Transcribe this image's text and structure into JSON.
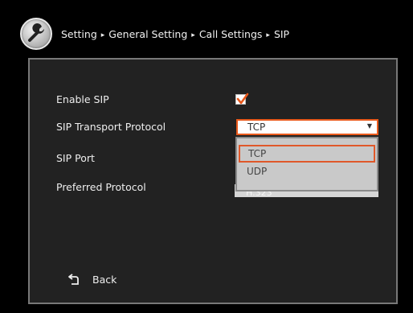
{
  "breadcrumb": {
    "items": [
      "Setting",
      "General Setting",
      "Call Settings",
      "SIP"
    ],
    "separator": "▸"
  },
  "form": {
    "enable_sip_label": "Enable SIP",
    "enable_sip_checked": true,
    "transport_label": "SIP Transport Protocol",
    "transport_value": "TCP",
    "sip_port_label": "SIP Port",
    "preferred_label": "Preferred Protocol",
    "preferred_value_partial": "H.323"
  },
  "dropdown": {
    "options": [
      "TCP",
      "UDP"
    ],
    "selected": "TCP"
  },
  "back_label": "Back",
  "colors": {
    "accent": "#e8571a",
    "panel_bg": "#222222",
    "panel_border": "#787878",
    "background": "#000000"
  },
  "icons": [
    "wrench-icon",
    "checkmark-icon",
    "dropdown-arrow-icon",
    "back-arrow-icon"
  ]
}
